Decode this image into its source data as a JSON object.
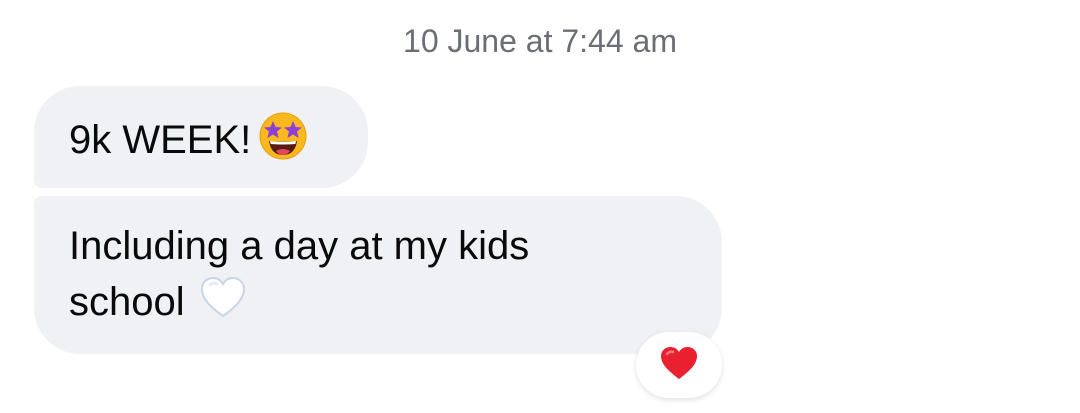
{
  "timestamp": "10 June at 7:44 am",
  "messages": [
    {
      "text": "9k WEEK!",
      "emoji": "star-struck-icon"
    },
    {
      "text_line1": "Including a day at my kids",
      "text_line2": "school",
      "emoji": "white-heart-icon"
    }
  ],
  "reaction": {
    "emoji": "red-heart-icon"
  },
  "colors": {
    "bubble": "#f0f1f5",
    "timestamp": "#6b6e74",
    "heart": "#e8202f"
  }
}
